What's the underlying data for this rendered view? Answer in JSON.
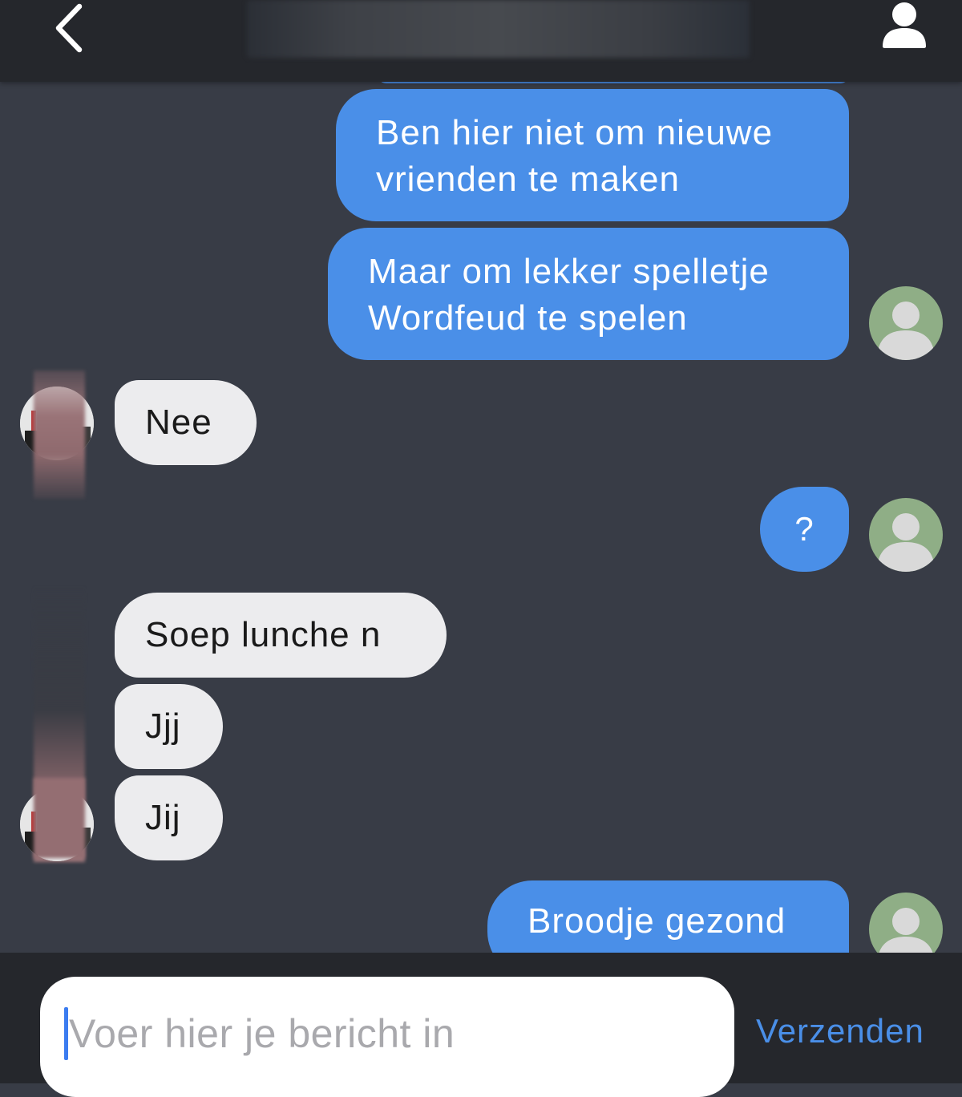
{
  "header": {
    "back_icon": "chevron-left-icon",
    "profile_icon": "user-icon"
  },
  "messages": [
    {
      "direction": "out",
      "lines": [
        "Ben hier niet om nieuwe",
        "vrienden te maken"
      ]
    },
    {
      "direction": "out",
      "lines": [
        "Maar om lekker spelletje",
        "Wordfeud te spelen"
      ]
    },
    {
      "direction": "in",
      "lines": [
        "Nee"
      ]
    },
    {
      "direction": "out",
      "lines": [
        "?"
      ]
    },
    {
      "direction": "in",
      "lines": [
        "Soep lunche n"
      ]
    },
    {
      "direction": "in",
      "lines": [
        "Jjj"
      ]
    },
    {
      "direction": "in",
      "lines": [
        "Jij"
      ]
    },
    {
      "direction": "out",
      "lines": [
        "Broodje gezond"
      ]
    }
  ],
  "composer": {
    "placeholder": "Voer hier je bericht in",
    "send_label": "Verzenden"
  },
  "colors": {
    "background": "#383c46",
    "bar": "#25272c",
    "outgoing_bubble": "#4a8fe8",
    "incoming_bubble": "#ececee",
    "accent": "#4a8fe8"
  }
}
